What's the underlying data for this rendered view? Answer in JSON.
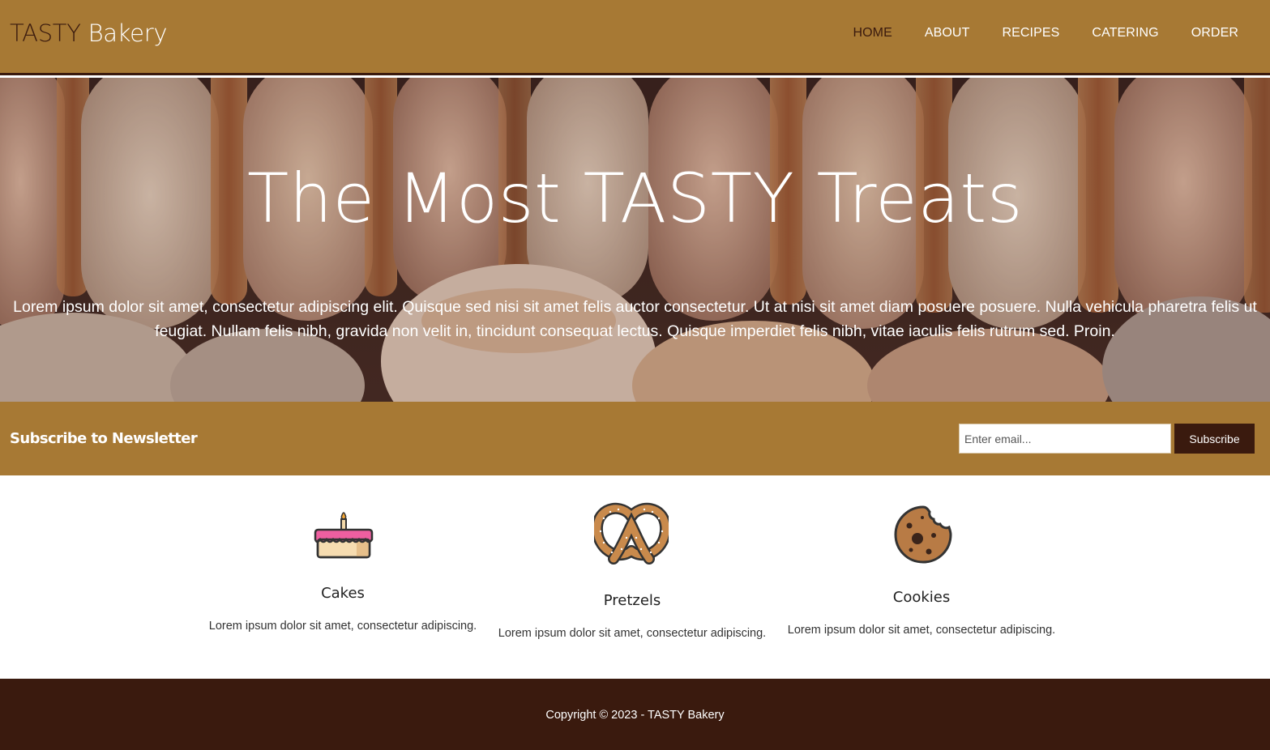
{
  "header": {
    "brand_part1": "TASTY",
    "brand_part2": "Bakery",
    "nav": [
      {
        "label": "HOME",
        "active": true
      },
      {
        "label": "ABOUT"
      },
      {
        "label": "RECIPES"
      },
      {
        "label": "CATERING"
      },
      {
        "label": "ORDER"
      }
    ]
  },
  "hero": {
    "title": "The Most TASTY Treats",
    "text": "Lorem ipsum dolor sit amet, consectetur adipiscing elit. Quisque sed nisi sit amet felis auctor consectetur. Ut at nisi sit amet diam posuere posuere. Nulla vehicula pharetra felis ut feugiat. Nullam felis nibh, gravida non velit in, tincidunt consequat lectus. Quisque imperdiet felis nibh, vitae iaculis felis rutrum sed. Proin."
  },
  "newsletter": {
    "title": "Subscribe to Newsletter",
    "email_placeholder": "Enter email...",
    "email_value": "",
    "button_label": "Subscribe"
  },
  "features": [
    {
      "name": "Cakes",
      "desc": "Lorem ipsum dolor sit amet, consectetur adipiscing.",
      "icon": "cake-icon"
    },
    {
      "name": "Pretzels",
      "desc": "Lorem ipsum dolor sit amet, consectetur adipiscing.",
      "icon": "pretzel-icon"
    },
    {
      "name": "Cookies",
      "desc": "Lorem ipsum dolor sit amet, consectetur adipiscing.",
      "icon": "cookie-icon"
    }
  ],
  "footer": {
    "copyright": "Copyright © 2023 - TASTY Bakery"
  },
  "colors": {
    "brand_gold": "#a77934",
    "brand_dark": "#3a1a0e"
  }
}
